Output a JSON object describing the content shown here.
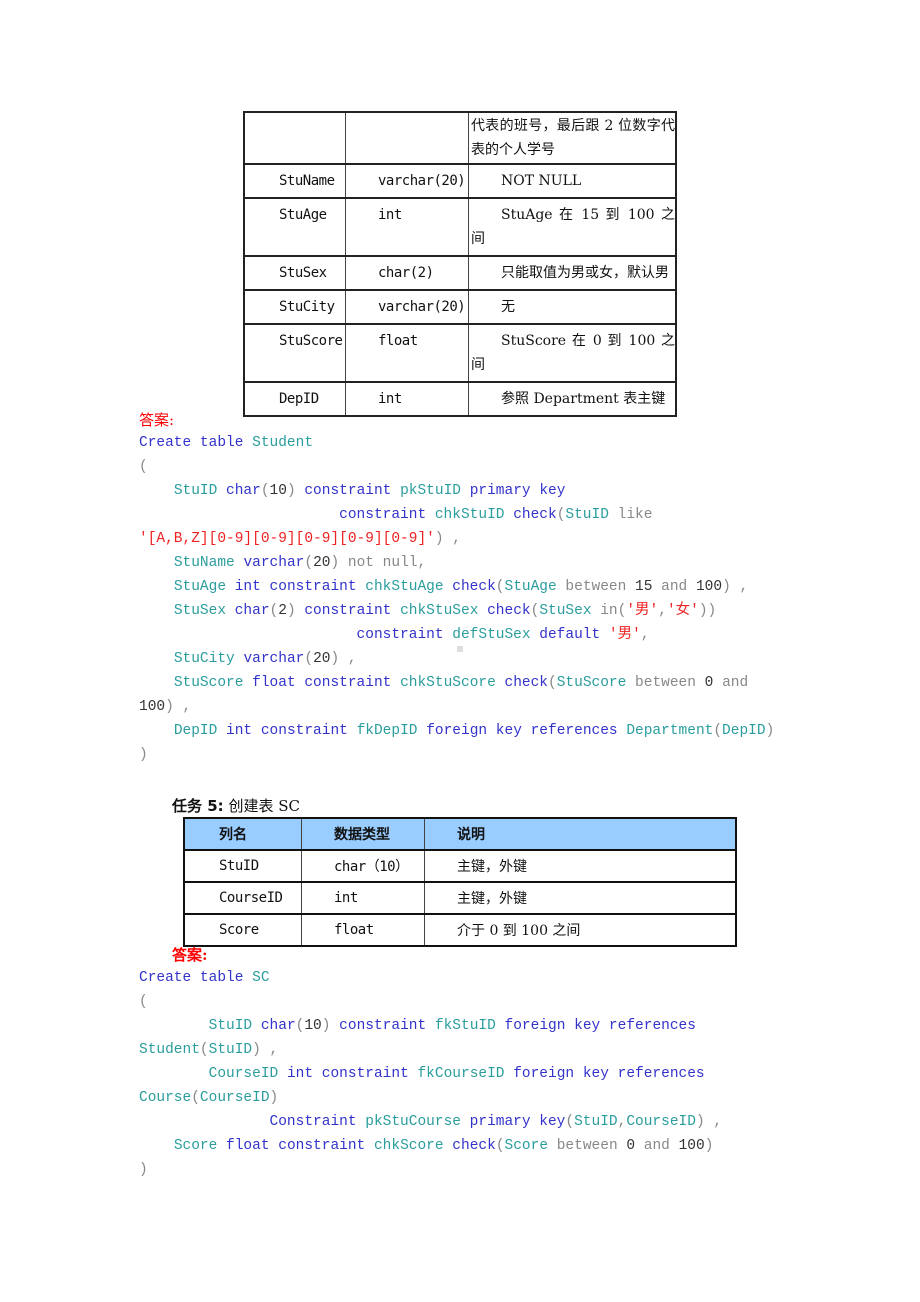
{
  "student_table": {
    "rows": [
      {
        "name": "",
        "type": "",
        "desc": "代表的班号，最后跟 2 位数字代表的个人学号"
      },
      {
        "name": "StuName",
        "type": "varchar(20)",
        "desc": "NOT NULL"
      },
      {
        "name": "StuAge",
        "type": "int",
        "desc": "StuAge 在 15 到 100 之间"
      },
      {
        "name": "StuSex",
        "type": "char(2)",
        "desc": "只能取值为男或女，默认男"
      },
      {
        "name": "StuCity",
        "type": "varchar(20)",
        "desc": "无"
      },
      {
        "name": "StuScore",
        "type": "float",
        "desc": "StuScore 在 0 到 100 之间"
      },
      {
        "name": "DepID",
        "type": "int",
        "desc": "参照 Department 表主键"
      }
    ]
  },
  "answer_label_1": "答案:",
  "code_student": [
    [
      [
        "kw",
        "Create table "
      ],
      [
        "id",
        "Student"
      ]
    ],
    [
      [
        "gr",
        "("
      ]
    ],
    [
      [
        "nm",
        "    "
      ],
      [
        "id",
        "StuID "
      ],
      [
        "kw",
        "char"
      ],
      [
        "gr",
        "("
      ],
      [
        "nm",
        "10"
      ],
      [
        "gr",
        ") "
      ],
      [
        "kw",
        "constraint "
      ],
      [
        "id",
        "pkStuID "
      ],
      [
        "kw",
        "primary key"
      ]
    ],
    [
      [
        "nm",
        "                       "
      ],
      [
        "kw",
        "constraint "
      ],
      [
        "id",
        "chkStuID "
      ],
      [
        "kw",
        "check"
      ],
      [
        "gr",
        "("
      ],
      [
        "id",
        "StuID "
      ],
      [
        "gr",
        "like"
      ]
    ],
    [
      [
        "st",
        "'[A,B,Z][0-9][0-9][0-9][0-9][0-9]'"
      ],
      [
        "gr",
        ") ,"
      ]
    ],
    [
      [
        "nm",
        "    "
      ],
      [
        "id",
        "StuName "
      ],
      [
        "kw",
        "varchar"
      ],
      [
        "gr",
        "("
      ],
      [
        "nm",
        "20"
      ],
      [
        "gr",
        ") not null,"
      ]
    ],
    [
      [
        "nm",
        "    "
      ],
      [
        "id",
        "StuAge "
      ],
      [
        "kw",
        "int constraint "
      ],
      [
        "id",
        "chkStuAge "
      ],
      [
        "kw",
        "check"
      ],
      [
        "gr",
        "("
      ],
      [
        "id",
        "StuAge "
      ],
      [
        "gr",
        "between "
      ],
      [
        "nm",
        "15 "
      ],
      [
        "gr",
        "and "
      ],
      [
        "nm",
        "100"
      ],
      [
        "gr",
        ") ,"
      ]
    ],
    [
      [
        "nm",
        "    "
      ],
      [
        "id",
        "StuSex "
      ],
      [
        "kw",
        "char"
      ],
      [
        "gr",
        "("
      ],
      [
        "nm",
        "2"
      ],
      [
        "gr",
        ") "
      ],
      [
        "kw",
        "constraint "
      ],
      [
        "id",
        "chkStuSex "
      ],
      [
        "kw",
        "check"
      ],
      [
        "gr",
        "("
      ],
      [
        "id",
        "StuSex "
      ],
      [
        "gr",
        "in("
      ],
      [
        "st",
        "'男'"
      ],
      [
        "gr",
        ","
      ],
      [
        "st",
        "'女'"
      ],
      [
        "gr",
        "))"
      ]
    ],
    [
      [
        "nm",
        "                         "
      ],
      [
        "kw",
        "constraint "
      ],
      [
        "id",
        "defStuSex "
      ],
      [
        "kw",
        "default "
      ],
      [
        "st",
        "'男'"
      ],
      [
        "gr",
        ","
      ]
    ],
    [
      [
        "nm",
        "    "
      ],
      [
        "id",
        "StuCity "
      ],
      [
        "kw",
        "varchar"
      ],
      [
        "gr",
        "("
      ],
      [
        "nm",
        "20"
      ],
      [
        "gr",
        ") ,"
      ]
    ],
    [
      [
        "nm",
        "    "
      ],
      [
        "id",
        "StuScore "
      ],
      [
        "kw",
        "float constraint "
      ],
      [
        "id",
        "chkStuScore "
      ],
      [
        "kw",
        "check"
      ],
      [
        "gr",
        "("
      ],
      [
        "id",
        "StuScore "
      ],
      [
        "gr",
        "between "
      ],
      [
        "nm",
        "0 "
      ],
      [
        "gr",
        "and"
      ]
    ],
    [
      [
        "nm",
        "100"
      ],
      [
        "gr",
        ") ,"
      ]
    ],
    [
      [
        "nm",
        "    "
      ],
      [
        "id",
        "DepID "
      ],
      [
        "kw",
        "int constraint "
      ],
      [
        "id",
        "fkDepID "
      ],
      [
        "kw",
        "foreign key references "
      ],
      [
        "id",
        "Department"
      ],
      [
        "gr",
        "("
      ],
      [
        "id",
        "DepID"
      ],
      [
        "gr",
        ")"
      ]
    ],
    [
      [
        "gr",
        ")"
      ]
    ]
  ],
  "task5": {
    "label": "任务 5:",
    "title": "创建表 SC"
  },
  "sc_table": {
    "headers": [
      "列名",
      "数据类型",
      "说明"
    ],
    "rows": [
      {
        "name": "StuID",
        "type": "char（10）",
        "desc": "主键，外键"
      },
      {
        "name": "CourseID",
        "type": "int",
        "desc": "主键，外键"
      },
      {
        "name": "Score",
        "type": "float",
        "desc": "介于 0 到 100 之间"
      }
    ]
  },
  "answer_label_2": "答案:",
  "code_sc": [
    [
      [
        "kw",
        "Create table "
      ],
      [
        "id",
        "SC"
      ]
    ],
    [
      [
        "gr",
        "("
      ]
    ],
    [
      [
        "nm",
        "        "
      ],
      [
        "id",
        "StuID "
      ],
      [
        "kw",
        "char"
      ],
      [
        "gr",
        "("
      ],
      [
        "nm",
        "10"
      ],
      [
        "gr",
        ") "
      ],
      [
        "kw",
        "constraint "
      ],
      [
        "id",
        "fkStuID "
      ],
      [
        "kw",
        "foreign key references"
      ]
    ],
    [
      [
        "id",
        "Student"
      ],
      [
        "gr",
        "("
      ],
      [
        "id",
        "StuID"
      ],
      [
        "gr",
        ") ,"
      ]
    ],
    [
      [
        "nm",
        "        "
      ],
      [
        "id",
        "CourseID "
      ],
      [
        "kw",
        "int constraint "
      ],
      [
        "id",
        "fkCourseID "
      ],
      [
        "kw",
        "foreign key references"
      ]
    ],
    [
      [
        "id",
        "Course"
      ],
      [
        "gr",
        "("
      ],
      [
        "id",
        "CourseID"
      ],
      [
        "gr",
        ")"
      ]
    ],
    [
      [
        "nm",
        "               "
      ],
      [
        "kw",
        "Constraint "
      ],
      [
        "id",
        "pkStuCourse "
      ],
      [
        "kw",
        "primary key"
      ],
      [
        "gr",
        "("
      ],
      [
        "id",
        "StuID"
      ],
      [
        "gr",
        ","
      ],
      [
        "id",
        "CourseID"
      ],
      [
        "gr",
        ") ,"
      ]
    ],
    [
      [
        "nm",
        "    "
      ],
      [
        "id",
        "Score "
      ],
      [
        "kw",
        "float constraint "
      ],
      [
        "id",
        "chkScore "
      ],
      [
        "kw",
        "check"
      ],
      [
        "gr",
        "("
      ],
      [
        "id",
        "Score "
      ],
      [
        "gr",
        "between "
      ],
      [
        "nm",
        "0 "
      ],
      [
        "gr",
        "and "
      ],
      [
        "nm",
        "100"
      ],
      [
        "gr",
        ")"
      ]
    ],
    [
      [
        "gr",
        ")"
      ]
    ]
  ]
}
